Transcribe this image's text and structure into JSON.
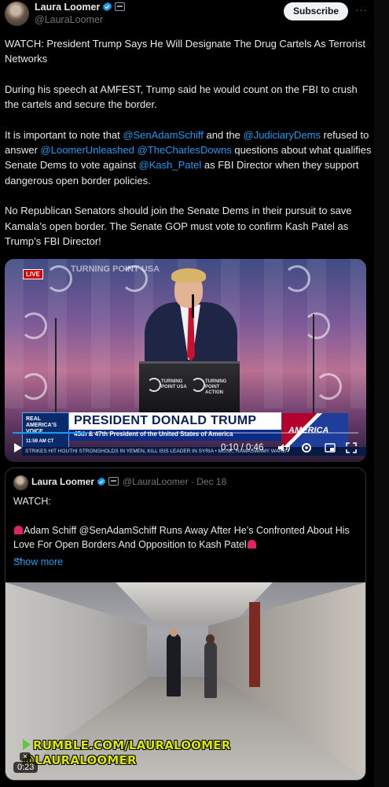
{
  "tweet": {
    "author_name": "Laura Loomer",
    "author_handle": "@LauraLoomer",
    "subscribe_label": "Subscribe",
    "more_label": "···",
    "paragraphs": [
      {
        "segments": [
          {
            "text": "WATCH: President Trump Says He Will Designate The Drug Cartels As Terrorist Networks"
          }
        ]
      },
      {
        "segments": [
          {
            "text": "During his speech at AMFEST, Trump said he would count on the FBI to crush the cartels and secure the border."
          }
        ]
      },
      {
        "segments": [
          {
            "text": "It is important to note that "
          },
          {
            "text": "@SenAdamSchiff",
            "link": true
          },
          {
            "text": " and the "
          },
          {
            "text": "@JudiciaryDems",
            "link": true
          },
          {
            "text": " refused to answer "
          },
          {
            "text": "@LoomerUnleashed",
            "link": true
          },
          {
            "text": " "
          },
          {
            "text": "@TheCharlesDowns",
            "link": true
          },
          {
            "text": " questions about what qualifies Senate Dems to vote against "
          },
          {
            "text": "@Kash_Patel",
            "link": true
          },
          {
            "text": " as FBI Director when they support dangerous open border policies."
          }
        ]
      },
      {
        "segments": [
          {
            "text": "No Republican Senators should join the Senate Dems in their pursuit to save Kamala’s open border. The Senate GOP must vote to confirm Kash Patel as Trump’s FBI Director!"
          }
        ]
      }
    ]
  },
  "video": {
    "live_badge": "LIVE",
    "backdrop_text": "TURNING POINT USA",
    "podium_left": "TURNING POINT USA",
    "podium_right": "TURNING POINT ACTION",
    "network_label": "REAL AMERICA'S VOICE",
    "network_time": "11:59 AM CT",
    "chyron_title": "PRESIDENT DONALD TRUMP",
    "chyron_subtitle": "45th & 47th President of the United States of America",
    "ticker": "STRIKES HIT HOUTHI STRONGHOLDS IN YEMEN, KILL ISIS LEADER IN SYRIA • MUSK, RAMASWAMY WARS",
    "side_logo": "AMERICA",
    "elapsed": "0:10",
    "duration": "0:46",
    "time_display": "0:10 / 0:46",
    "progress": 0.217
  },
  "quote": {
    "author_name": "Laura Loomer",
    "author_handle": "@LauraLoomer",
    "date": "Dec 18",
    "line1": "WATCH:",
    "line2": "Adam Schiff @SenAdamSchiff Runs Away After He’s Confronted About His Love For Open Borders And Opposition to Kash Patel",
    "line3": "...",
    "show_more": "Show more",
    "watermark_line1": "RUMBLE.COM/LAURALOOMER",
    "watermark_line2": "@LAURALOOMER",
    "video_time": "0:23"
  },
  "colors": {
    "link": "#1d9bf0",
    "background": "#000000",
    "text": "#e7e9ea",
    "muted": "#71767b"
  },
  "icons": [
    "verified-badge-icon",
    "affiliate-badge-icon",
    "play-icon",
    "volume-icon",
    "settings-icon",
    "fullscreen-icon",
    "mute-icon"
  ]
}
